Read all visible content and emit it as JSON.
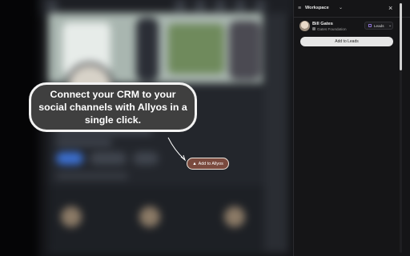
{
  "callout": {
    "text": "Connect your CRM to your social channels with Allyos in a single click."
  },
  "inline_button": {
    "label": "Add to Allyos",
    "icon": "allyos-logo-icon"
  },
  "panel": {
    "workspace_label": "Workspace",
    "workspace_icon": "workspace-icon",
    "close_icon": "close-icon",
    "contact": {
      "name": "Bill Gates",
      "company": "Gates Foundation"
    },
    "list_selector": {
      "label": "Leads",
      "icon": "list-grid-icon"
    },
    "add_button": "Add to Leads"
  },
  "colors": {
    "panel_bg": "#151517",
    "callout_bg": "#3f3f3f",
    "allyos_button": "#7a4a3e",
    "add_button_bg": "#e6e6e6"
  }
}
